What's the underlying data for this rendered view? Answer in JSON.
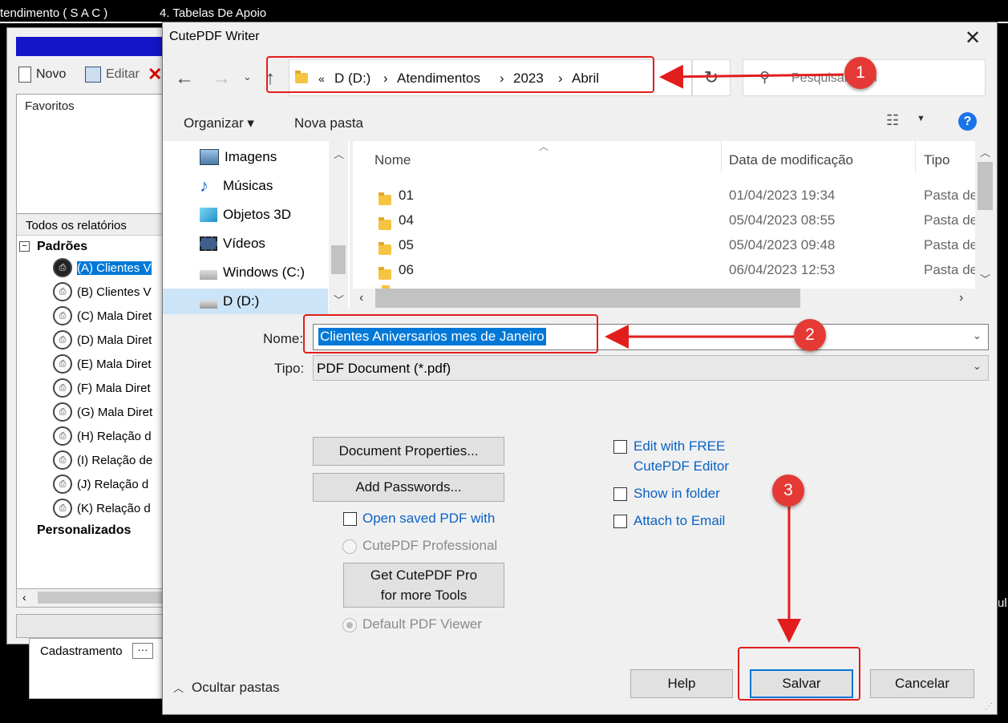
{
  "background_app": {
    "menu": [
      "tendimento ( S A C )",
      "4. Tabelas De Apoio"
    ],
    "toolbar": {
      "new": "Novo",
      "edit": "Editar"
    },
    "favorites_label": "Favoritos",
    "all_reports_label": "Todos os relatórios",
    "group_standard": "Padrões",
    "reports": [
      "(A) Clientes V",
      "(B) Clientes V",
      "(C) Mala Diret",
      "(D) Mala Diret",
      "(E) Mala Diret",
      "(F) Mala Diret",
      "(G) Mala Diret",
      "(H) Relação d",
      "(I) Relação de",
      "(J) Relação d",
      "(K) Relação d"
    ],
    "group_custom": "Personalizados",
    "bottom_field_label": "Cadastramento",
    "bottom_field_button": "···",
    "edge_text": "ul"
  },
  "dialog": {
    "title": "CutePDF Writer",
    "address": {
      "overflow": "«",
      "crumbs": [
        "D (D:)",
        "Atendimentos",
        "2023",
        "Abril"
      ]
    },
    "search_placeholder": "Pesquisar Abril",
    "toolbar": {
      "organize": "Organizar ▾",
      "new_folder": "Nova pasta"
    },
    "nav_items": [
      "Imagens",
      "Músicas",
      "Objetos 3D",
      "Vídeos",
      "Windows (C:)",
      "D (D:)"
    ],
    "columns": {
      "name": "Nome",
      "modified": "Data de modificação",
      "type": "Tipo"
    },
    "files": [
      {
        "name": "01",
        "date": "01/04/2023 19:34",
        "type": "Pasta de"
      },
      {
        "name": "04",
        "date": "05/04/2023 08:55",
        "type": "Pasta de"
      },
      {
        "name": "05",
        "date": "05/04/2023 09:48",
        "type": "Pasta de"
      },
      {
        "name": "06",
        "date": "06/04/2023 12:53",
        "type": "Pasta de"
      }
    ],
    "filename_label": "Nome:",
    "filename_value": "Clientes Aniversarios mes de Janeiro",
    "filetype_label": "Tipo:",
    "filetype_value": "PDF Document (*.pdf)",
    "buttons": {
      "doc_props": "Document Properties...",
      "add_passwords": "Add Passwords...",
      "get_pro_line1": "Get CutePDF Pro",
      "get_pro_line2": "for more Tools",
      "help": "Help",
      "save": "Salvar",
      "cancel": "Cancelar"
    },
    "options": {
      "open_saved": "Open saved PDF with",
      "cutepdf_pro": "CutePDF Professional",
      "default_viewer": "Default PDF Viewer",
      "edit_free_line1": "Edit with FREE",
      "edit_free_line2": "CutePDF Editor",
      "show_in_folder": "Show in folder",
      "attach_email": "Attach to Email"
    },
    "hide_folders": "Ocultar pastas"
  },
  "annotations": [
    "1",
    "2",
    "3"
  ],
  "colors": {
    "annotation_red": "#e21d1d",
    "selection_blue": "#0078d7",
    "link_blue": "#0a62c4"
  }
}
